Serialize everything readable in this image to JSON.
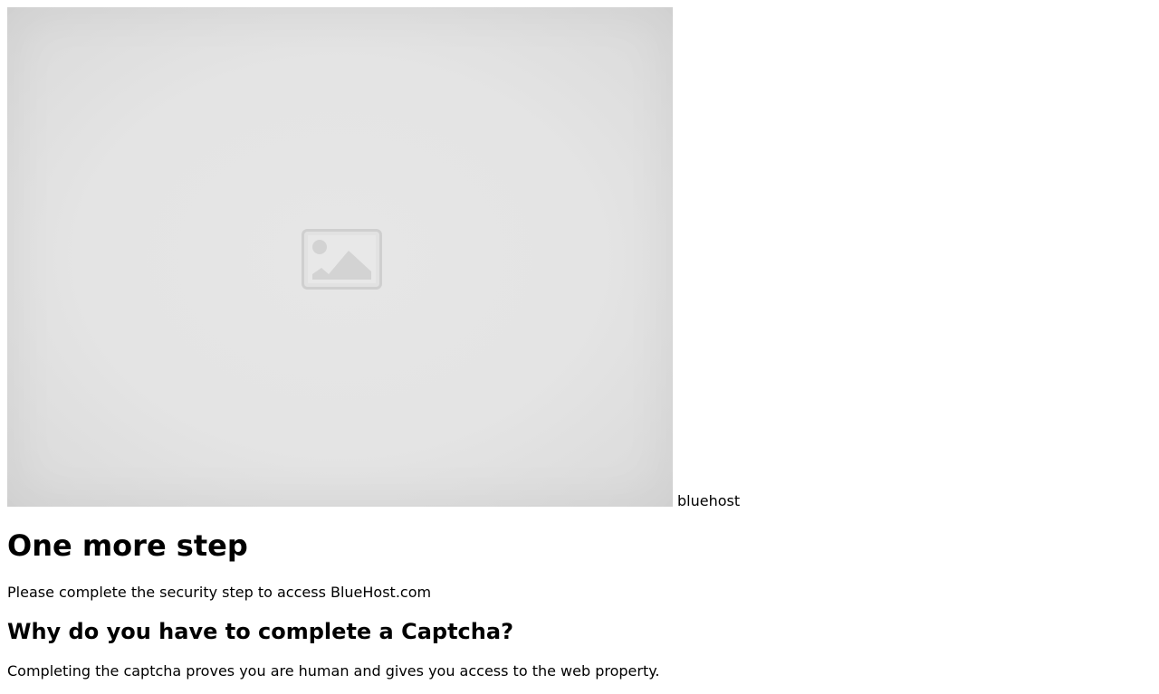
{
  "hero": {
    "image_icon": "image-placeholder-icon",
    "brand_text": "bluehost"
  },
  "main": {
    "title": "One more step",
    "subtitle": "Please complete the security step to access BlueHost.com",
    "section_heading": "Why do you have to complete a Captcha?",
    "section_body": "Completing the captcha proves you are human and gives you access to the web property."
  },
  "colors": {
    "background": "#ffffff",
    "text": "#000000",
    "placeholder_bg": "#e4e4e4",
    "placeholder_icon": "#d0d0d0"
  }
}
